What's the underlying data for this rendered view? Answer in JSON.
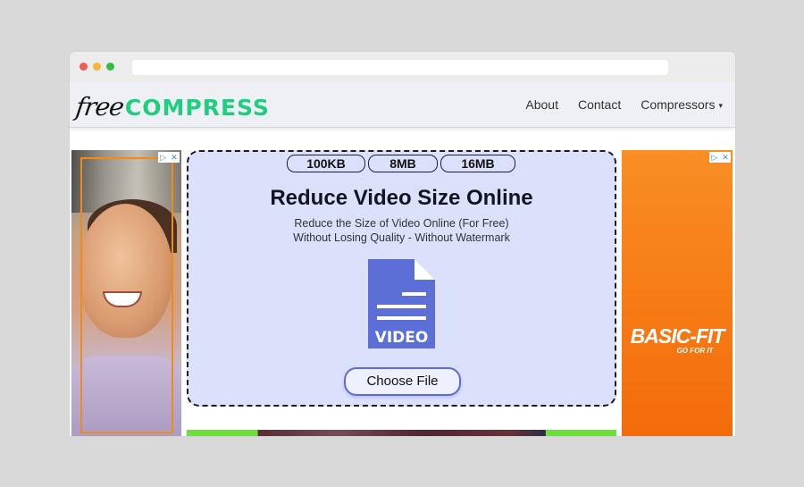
{
  "browser": {
    "window_controls": [
      "close",
      "minimize",
      "maximize"
    ],
    "url": ""
  },
  "navbar": {
    "logo": {
      "prefix": "free",
      "suffix": "COMPRESS"
    },
    "links": [
      {
        "label": "About"
      },
      {
        "label": "Contact"
      },
      {
        "label": "Compressors",
        "dropdown_icon": "▾"
      }
    ]
  },
  "upload": {
    "size_tabs": [
      "100KB",
      "8MB",
      "16MB"
    ],
    "title": "Reduce Video Size Online",
    "subtitle_line1": "Reduce the Size of Video Online (For Free)",
    "subtitle_line2": "Without Losing Quality - Without Watermark",
    "file_icon_label": "VIDEO",
    "choose_button": "Choose File"
  },
  "ads": {
    "left": {
      "adchoices_icon": "▷",
      "close_icon": "✕"
    },
    "right": {
      "adchoices_icon": "▷",
      "close_icon": "✕",
      "brand": "BASIC-FIT",
      "tagline": "GO FOR IT"
    }
  },
  "colors": {
    "brand_green": "#1fcf7f",
    "upload_bg": "#dbe1fb",
    "button_border": "#5f6bd3",
    "file_icon": "#5b6fd6",
    "ad_orange": "#f77c16"
  }
}
